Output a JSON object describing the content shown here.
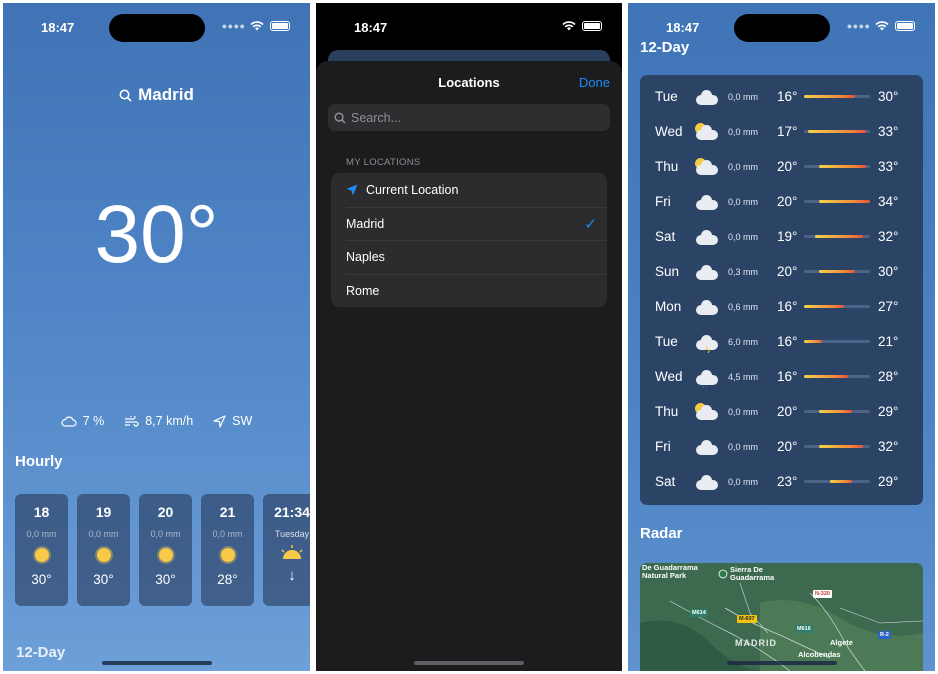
{
  "status_bar": {
    "time": "18:47"
  },
  "weather": {
    "city": "Madrid",
    "temperature": "30°",
    "conditions": {
      "cloud": "7 %",
      "wind_speed": "8,7 km/h",
      "wind_direction": "SW"
    },
    "hourly_label": "Hourly",
    "hourly": [
      {
        "hour": "18",
        "precip": "0,0 mm",
        "temp": "30°",
        "icon": "sun-icon"
      },
      {
        "hour": "19",
        "precip": "0,0 mm",
        "temp": "30°",
        "icon": "sun-icon"
      },
      {
        "hour": "20",
        "precip": "0,0 mm",
        "temp": "30°",
        "icon": "sun-icon"
      },
      {
        "hour": "21",
        "precip": "0,0 mm",
        "temp": "28°",
        "icon": "sun-icon"
      }
    ],
    "sunset": {
      "time": "21:34",
      "day": "Tuesday",
      "icon": "sunset-icon"
    },
    "twelve_day_label": "12-Day"
  },
  "locations": {
    "title": "Locations",
    "done": "Done",
    "search_placeholder": "Search...",
    "section": "MY LOCATIONS",
    "items": [
      {
        "label": "Current Location",
        "icon": "location-arrow-icon",
        "selected": false
      },
      {
        "label": "Madrid",
        "selected": true
      },
      {
        "label": "Naples",
        "selected": false
      },
      {
        "label": "Rome",
        "selected": false
      }
    ]
  },
  "forecast": {
    "title": "12-Day",
    "radar_title": "Radar",
    "scale": {
      "min": 16,
      "max": 34
    },
    "days": [
      {
        "day": "Tue",
        "icon": "cloud",
        "precip": "0,0 mm",
        "low": "16°",
        "high": "30°",
        "low_v": 16,
        "high_v": 30
      },
      {
        "day": "Wed",
        "icon": "partly-sunny",
        "precip": "0,0 mm",
        "low": "17°",
        "high": "33°",
        "low_v": 17,
        "high_v": 33
      },
      {
        "day": "Thu",
        "icon": "partly-sunny",
        "precip": "0,0 mm",
        "low": "20°",
        "high": "33°",
        "low_v": 20,
        "high_v": 33
      },
      {
        "day": "Fri",
        "icon": "cloud",
        "precip": "0,0 mm",
        "low": "20°",
        "high": "34°",
        "low_v": 20,
        "high_v": 34
      },
      {
        "day": "Sat",
        "icon": "cloud",
        "precip": "0,0 mm",
        "low": "19°",
        "high": "32°",
        "low_v": 19,
        "high_v": 32
      },
      {
        "day": "Sun",
        "icon": "cloud",
        "precip": "0,3 mm",
        "low": "20°",
        "high": "30°",
        "low_v": 20,
        "high_v": 30
      },
      {
        "day": "Mon",
        "icon": "cloud",
        "precip": "0,6 mm",
        "low": "16°",
        "high": "27°",
        "low_v": 16,
        "high_v": 27
      },
      {
        "day": "Tue",
        "icon": "thunder",
        "precip": "6,0 mm",
        "low": "16°",
        "high": "21°",
        "low_v": 16,
        "high_v": 21
      },
      {
        "day": "Wed",
        "icon": "rain",
        "precip": "4,5 mm",
        "low": "16°",
        "high": "28°",
        "low_v": 16,
        "high_v": 28
      },
      {
        "day": "Thu",
        "icon": "partly-sunny",
        "precip": "0,0 mm",
        "low": "20°",
        "high": "29°",
        "low_v": 20,
        "high_v": 29
      },
      {
        "day": "Fri",
        "icon": "cloud",
        "precip": "0,0 mm",
        "low": "20°",
        "high": "32°",
        "low_v": 20,
        "high_v": 32
      },
      {
        "day": "Sat",
        "icon": "cloud",
        "precip": "0,0 mm",
        "low": "23°",
        "high": "29°",
        "low_v": 23,
        "high_v": 29
      }
    ],
    "map_labels": {
      "park": "De Guadarrama\nNatural Park",
      "sierra": "Sierra De\nGuadarrama",
      "madrid": "MADRID",
      "algete": "Algete",
      "alcobendas": "Alcobendas",
      "r320": "N-320",
      "m614": "M614",
      "m607": "M-607",
      "m616": "M616",
      "r2": "R-2"
    }
  }
}
